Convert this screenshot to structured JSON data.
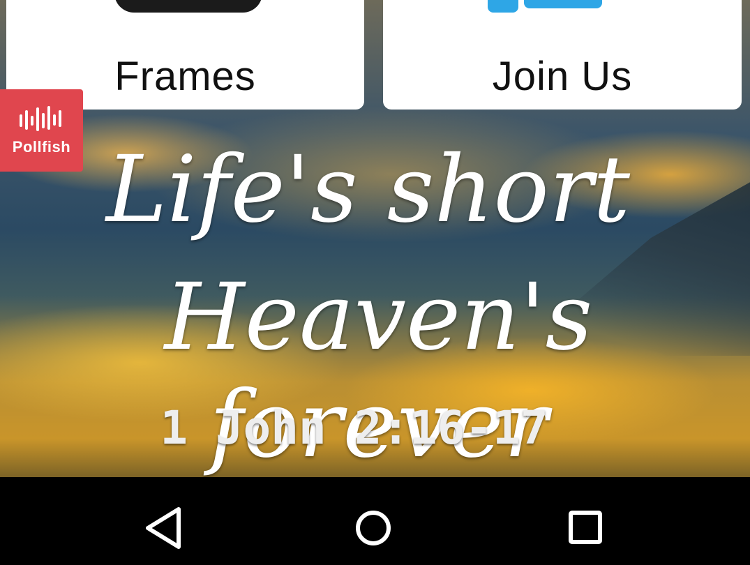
{
  "cards": [
    {
      "label": "Frames",
      "icon": "frames-icon"
    },
    {
      "label": "Join Us",
      "icon": "join-us-icon"
    }
  ],
  "ad_badge": {
    "label": "Pollfish",
    "icon": "pollfish-audio-bars-icon",
    "color": "#e0464e"
  },
  "banner": {
    "line1": "Life's short",
    "line2": "Heaven's forever",
    "verse": "1 John 2:16-17"
  },
  "nav_bar": {
    "back_icon": "back-triangle-icon",
    "home_icon": "home-circle-icon",
    "recents_icon": "recents-square-icon"
  }
}
